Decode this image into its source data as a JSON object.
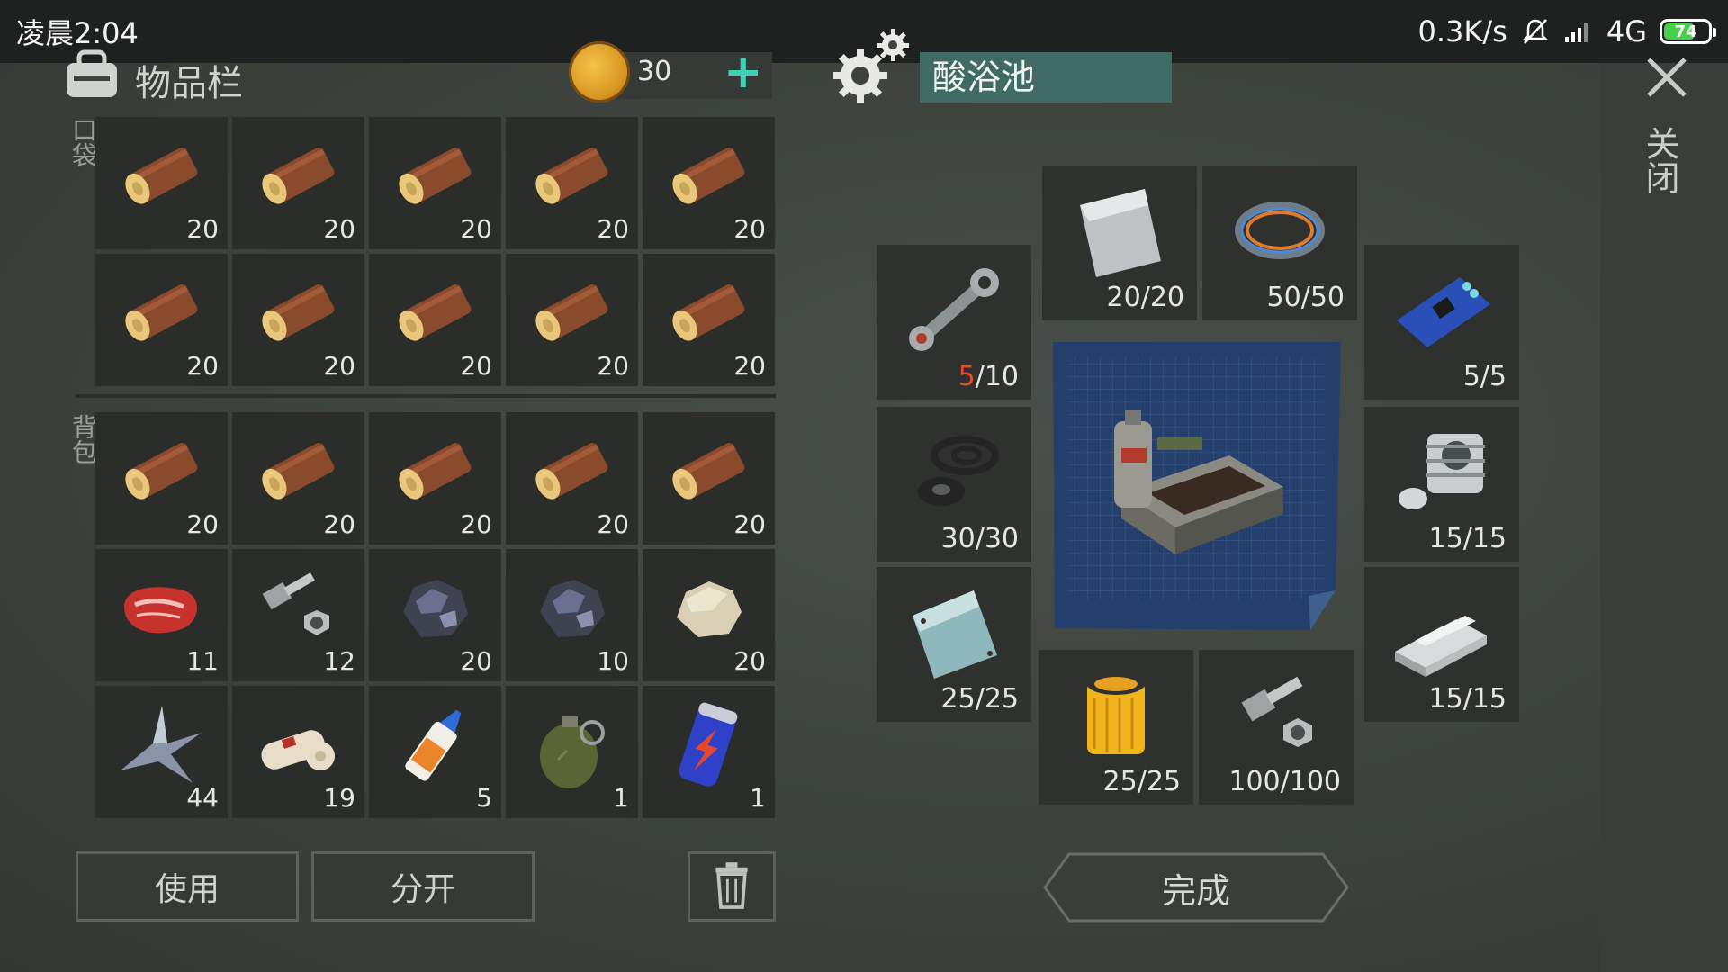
{
  "status": {
    "time": "凌晨2:04",
    "network_speed": "0.3K/s",
    "network": "4G",
    "battery": "74"
  },
  "inventory": {
    "title": "物品栏",
    "coins": "30",
    "add_label": "+",
    "pocket_label": "口袋",
    "backpack_label": "背包",
    "pocket_items": [
      {
        "icon": "log-icon",
        "count": "20"
      },
      {
        "icon": "log-icon",
        "count": "20"
      },
      {
        "icon": "log-icon",
        "count": "20"
      },
      {
        "icon": "log-icon",
        "count": "20"
      },
      {
        "icon": "log-icon",
        "count": "20"
      },
      {
        "icon": "log-icon",
        "count": "20"
      },
      {
        "icon": "log-icon",
        "count": "20"
      },
      {
        "icon": "log-icon",
        "count": "20"
      },
      {
        "icon": "log-icon",
        "count": "20"
      },
      {
        "icon": "log-icon",
        "count": "20"
      }
    ],
    "backpack_items": [
      {
        "icon": "log-icon",
        "count": "20"
      },
      {
        "icon": "log-icon",
        "count": "20"
      },
      {
        "icon": "log-icon",
        "count": "20"
      },
      {
        "icon": "log-icon",
        "count": "20"
      },
      {
        "icon": "log-icon",
        "count": "20"
      },
      {
        "icon": "raw-meat-icon",
        "count": "11"
      },
      {
        "icon": "bolt-nut-icon",
        "count": "12"
      },
      {
        "icon": "iron-ore-icon",
        "count": "20"
      },
      {
        "icon": "iron-ore-icon",
        "count": "10"
      },
      {
        "icon": "stone-icon",
        "count": "20"
      },
      {
        "icon": "scrap-metal-icon",
        "count": "44"
      },
      {
        "icon": "bandage-icon",
        "count": "19"
      },
      {
        "icon": "glue-icon",
        "count": "5"
      },
      {
        "icon": "grenade-icon",
        "count": "1"
      },
      {
        "icon": "energy-drink-icon",
        "count": "1"
      }
    ]
  },
  "buttons": {
    "use": "使用",
    "split": "分开",
    "done": "完成"
  },
  "close_label": "关闭",
  "craft": {
    "name": "酸浴池",
    "requirements": [
      {
        "icon": "steel-plate-icon",
        "have": "20",
        "need": "20"
      },
      {
        "icon": "wire-icon",
        "have": "50",
        "need": "50"
      },
      {
        "icon": "connecting-rod-icon",
        "have": "5",
        "need": "10"
      },
      {
        "icon": "circuit-board-icon",
        "have": "5",
        "need": "5"
      },
      {
        "icon": "rubber-seals-icon",
        "have": "30",
        "need": "30"
      },
      {
        "icon": "engine-cylinder-icon",
        "have": "15",
        "need": "15"
      },
      {
        "icon": "glass-panel-icon",
        "have": "25",
        "need": "25"
      },
      {
        "icon": "aluminum-ingot-icon",
        "have": "15",
        "need": "15"
      },
      {
        "icon": "oil-filter-icon",
        "have": "25",
        "need": "25"
      },
      {
        "icon": "bolt-nut-icon",
        "have": "100",
        "need": "100"
      }
    ]
  }
}
